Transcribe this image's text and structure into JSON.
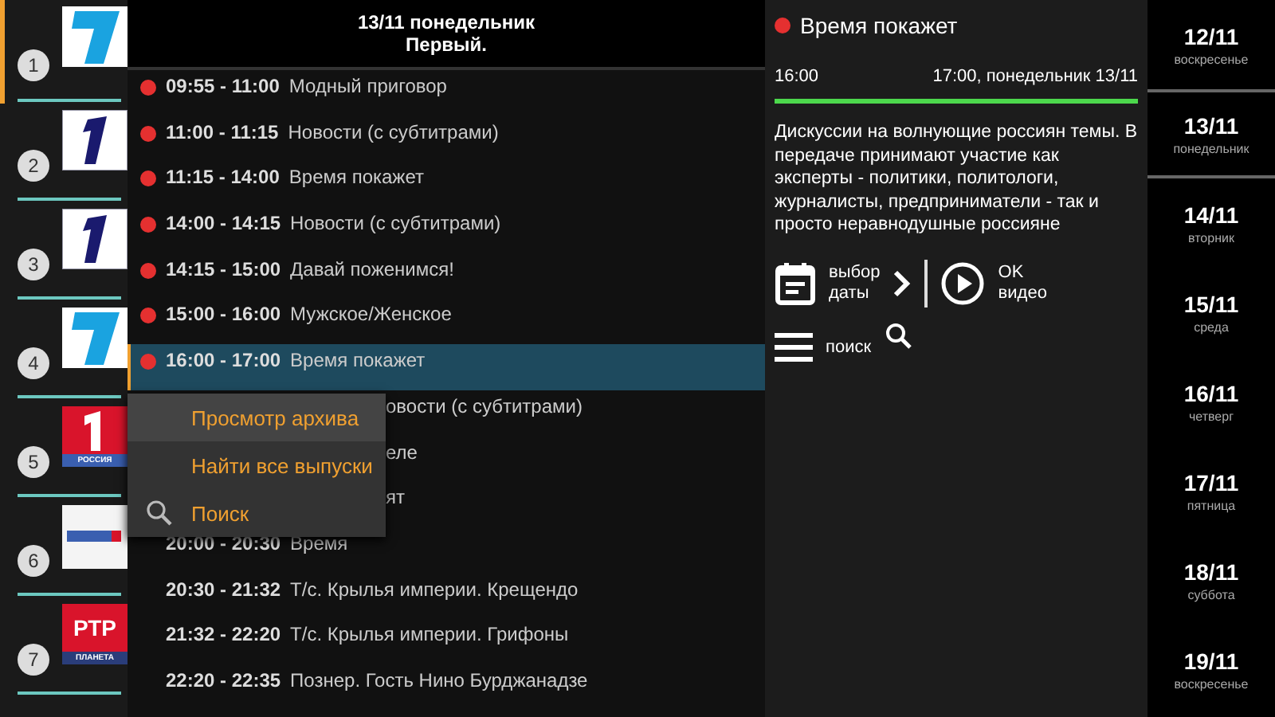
{
  "channels": [
    {
      "number": "1",
      "kind": "light",
      "selected": true
    },
    {
      "number": "2",
      "kind": "dark",
      "selected": false
    },
    {
      "number": "3",
      "kind": "dark",
      "selected": false
    },
    {
      "number": "4",
      "kind": "light",
      "selected": false
    },
    {
      "number": "5",
      "kind": "red",
      "caption": "РОССИЯ",
      "selected": false
    },
    {
      "number": "6",
      "kind": "banner",
      "selected": false
    },
    {
      "number": "7",
      "kind": "lettered",
      "mark": "РТР",
      "caption": "ПЛАНЕТА",
      "selected": false
    }
  ],
  "header": {
    "date": "13/11  понедельник",
    "channel": "Первый."
  },
  "programmes": [
    {
      "kind": "full",
      "time": "09:55 - 11:00",
      "title": "Модный приговор",
      "archive": true,
      "selected": false
    },
    {
      "kind": "full",
      "time": "11:00 - 11:15",
      "title": "Новости (с субтитрами)",
      "archive": true,
      "selected": false
    },
    {
      "kind": "full",
      "time": "11:15 - 14:00",
      "title": "Время покажет",
      "archive": true,
      "selected": false
    },
    {
      "kind": "full",
      "time": "14:00 - 14:15",
      "title": "Новости (с субтитрами)",
      "archive": true,
      "selected": false
    },
    {
      "kind": "full",
      "time": "14:15 - 15:00",
      "title": "Давай поженимся!",
      "archive": true,
      "selected": false
    },
    {
      "kind": "full",
      "time": "15:00 - 16:00",
      "title": "Мужское/Женское",
      "archive": true,
      "selected": false
    },
    {
      "kind": "full",
      "time": "16:00 - 17:00",
      "title": "Время покажет",
      "archive": true,
      "selected": true
    },
    {
      "kind": "covered",
      "title": "овости (с субтитрами)"
    },
    {
      "kind": "covered",
      "title": "еле"
    },
    {
      "kind": "covered",
      "title": "ят"
    },
    {
      "kind": "full",
      "time": "20:00 - 20:30",
      "title": "Время",
      "archive": false,
      "selected": false
    },
    {
      "kind": "full",
      "time": "20:30 - 21:32",
      "title": "Т/с. Крылья империи. Крещендо",
      "archive": false,
      "selected": false
    },
    {
      "kind": "full",
      "time": "21:32 - 22:20",
      "title": "Т/с. Крылья империи. Грифоны",
      "archive": false,
      "selected": false
    },
    {
      "kind": "full",
      "time": "22:20 - 22:35",
      "title": "Познер. Гость Нино Бурджанадзе",
      "archive": false,
      "selected": false
    }
  ],
  "context_menu": [
    {
      "label": "Просмотр архива",
      "kind": "plain",
      "selected": true
    },
    {
      "label": "Найти все выпуски",
      "kind": "plain",
      "selected": false
    },
    {
      "label": "Поиск",
      "kind": "search",
      "selected": false
    }
  ],
  "details": {
    "title": "Время покажет",
    "archive": true,
    "start": "16:00",
    "end": "17:00, понедельник 13/11",
    "level": 1,
    "description": "Дискуссии на волнующие россиян темы. В передаче принимают участие как эксперты - политики, политологи, журналисты, предприниматели - так и просто неравнодушные россияне",
    "date_hint": [
      "выбор",
      "даты"
    ],
    "play_hint": [
      "OK",
      "видео"
    ],
    "search_hint": "поиск"
  },
  "dates": [
    {
      "date": "12/11",
      "weekday": "воскресенье",
      "selected": false
    },
    {
      "date": "13/11",
      "weekday": "понедельник",
      "selected": true
    },
    {
      "date": "14/11",
      "weekday": "вторник",
      "selected": false
    },
    {
      "date": "15/11",
      "weekday": "среда",
      "selected": false
    },
    {
      "date": "16/11",
      "weekday": "четверг",
      "selected": false
    },
    {
      "date": "17/11",
      "weekday": "пятница",
      "selected": false
    },
    {
      "date": "18/11",
      "weekday": "суббота",
      "selected": false
    },
    {
      "date": "19/11",
      "weekday": "воскресенье",
      "selected": false
    }
  ]
}
